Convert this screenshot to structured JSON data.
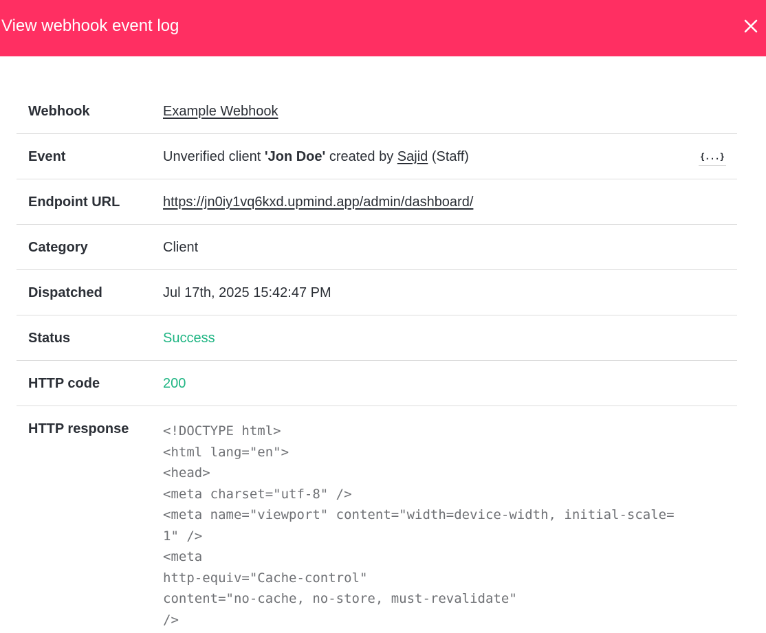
{
  "header": {
    "title": "View webhook event log",
    "close_icon": "close-icon"
  },
  "colors": {
    "header_bg": "#ff2f62",
    "success": "#1fb583"
  },
  "rows": {
    "webhook": {
      "label": "Webhook",
      "value": "Example Webhook"
    },
    "event": {
      "label": "Event",
      "prefix": "Unverified client ",
      "client_name": "'Jon Doe'",
      "middle": " created by ",
      "actor": "Sajid",
      "suffix": " (Staff)",
      "json_button": "{...}"
    },
    "endpoint": {
      "label": "Endpoint URL",
      "value": "https://jn0iy1vq6kxd.upmind.app/admin/dashboard/"
    },
    "category": {
      "label": "Category",
      "value": "Client"
    },
    "dispatched": {
      "label": "Dispatched",
      "value": "Jul 17th, 2025 15:42:47 PM"
    },
    "status": {
      "label": "Status",
      "value": "Success"
    },
    "http_code": {
      "label": "HTTP code",
      "value": "200"
    },
    "http_response": {
      "label": "HTTP response",
      "lines": [
        "<!DOCTYPE html>",
        "<html lang=\"en\">",
        "<head>",
        "<meta charset=\"utf-8\" />",
        "<meta name=\"viewport\" content=\"width=device-width, initial-scale=",
        "1\" />",
        "<meta",
        "http-equiv=\"Cache-control\"",
        "content=\"no-cache, no-store, must-revalidate\"",
        "/>"
      ]
    }
  }
}
